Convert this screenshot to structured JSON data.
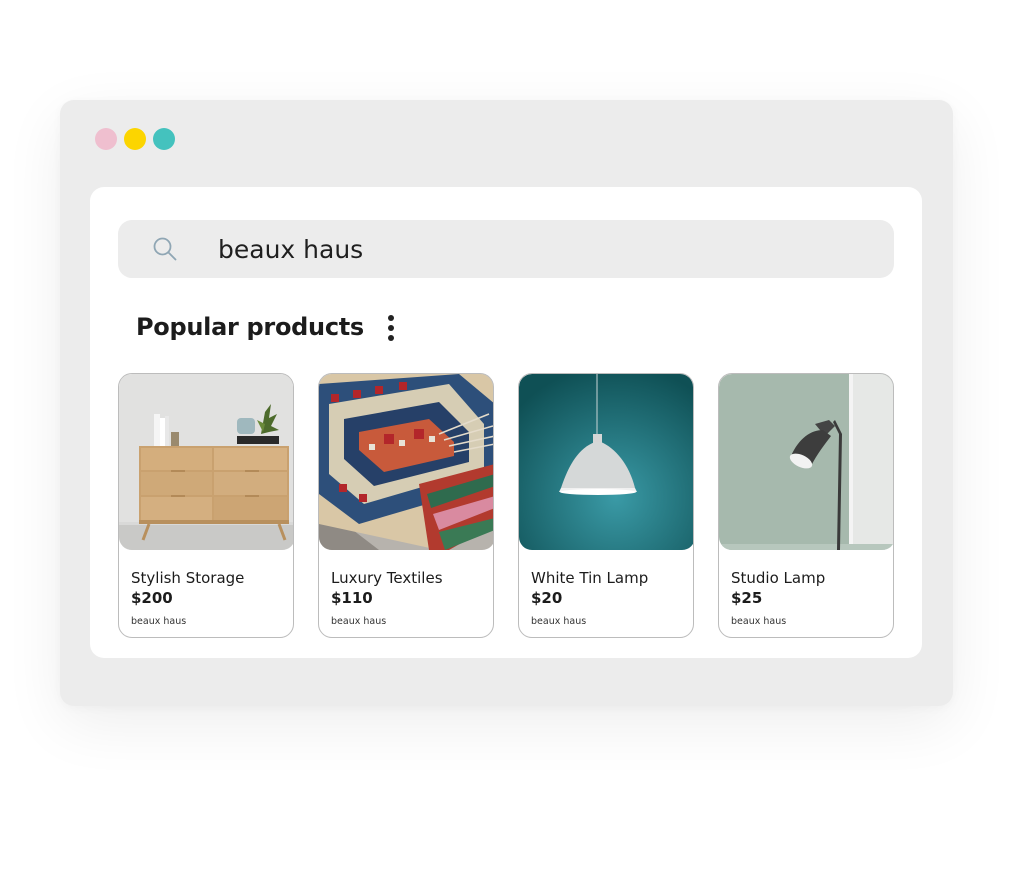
{
  "window": {
    "controls": [
      {
        "name": "close",
        "color": "#efbfcf"
      },
      {
        "name": "minimize",
        "color": "#fcd500"
      },
      {
        "name": "maximize",
        "color": "#44c2be"
      }
    ]
  },
  "search": {
    "icon": "search-icon",
    "value": "beaux haus",
    "placeholder": ""
  },
  "section": {
    "title": "Popular products",
    "menu_icon": "more-vertical-icon"
  },
  "products": [
    {
      "name": "Stylish Storage",
      "price": "$200",
      "brand": "beaux haus",
      "image": "wooden-dresser-image"
    },
    {
      "name": "Luxury Textiles",
      "price": "$110",
      "brand": "beaux haus",
      "image": "woven-rug-image"
    },
    {
      "name": "White Tin Lamp",
      "price": "$20",
      "brand": "beaux haus",
      "image": "pendant-lamp-image"
    },
    {
      "name": "Studio Lamp",
      "price": "$25",
      "brand": "beaux haus",
      "image": "floor-lamp-image"
    }
  ],
  "colors": {
    "window_bg": "#ececec",
    "panel_bg": "#ffffff",
    "text": "#1c1c1c",
    "card_border": "#bcbcbc"
  }
}
